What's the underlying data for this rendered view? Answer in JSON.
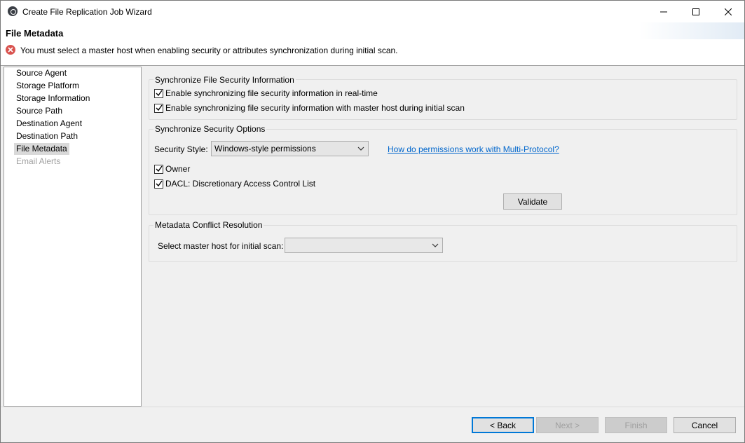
{
  "window": {
    "title": "Create File Replication Job Wizard",
    "icon": "app-icon"
  },
  "header": {
    "page_title": "File Metadata",
    "error_message": "You must select a master host when enabling security or attributes synchronization during initial scan."
  },
  "nav": {
    "items": [
      {
        "label": "Source Agent",
        "state": "normal"
      },
      {
        "label": "Storage Platform",
        "state": "normal"
      },
      {
        "label": "Storage Information",
        "state": "normal"
      },
      {
        "label": "Source Path",
        "state": "normal"
      },
      {
        "label": "Destination Agent",
        "state": "normal"
      },
      {
        "label": "Destination Path",
        "state": "normal"
      },
      {
        "label": "File Metadata",
        "state": "selected"
      },
      {
        "label": "Email Alerts",
        "state": "disabled"
      }
    ]
  },
  "sync_security": {
    "title": "Synchronize File Security Information",
    "realtime_label": "Enable synchronizing file security information in real-time",
    "realtime_checked": true,
    "initial_scan_label": "Enable synchronizing file security information with master host during initial scan",
    "initial_scan_checked": true
  },
  "security_options": {
    "title": "Synchronize Security Options",
    "style_label": "Security Style:",
    "style_value": "Windows-style permissions",
    "help_link": "How do permissions work with Multi-Protocol?",
    "owner_label": "Owner",
    "owner_checked": true,
    "dacl_label": "DACL: Discretionary Access Control List",
    "dacl_checked": true,
    "validate_label": "Validate"
  },
  "conflict": {
    "title": "Metadata Conflict Resolution",
    "master_host_label": "Select master host for initial scan:",
    "master_host_value": ""
  },
  "footer": {
    "back_label": "< Back",
    "next_label": "Next >",
    "finish_label": "Finish",
    "cancel_label": "Cancel"
  },
  "colors": {
    "error": "#d9534f",
    "link": "#0066cc",
    "focus": "#0078d7"
  }
}
